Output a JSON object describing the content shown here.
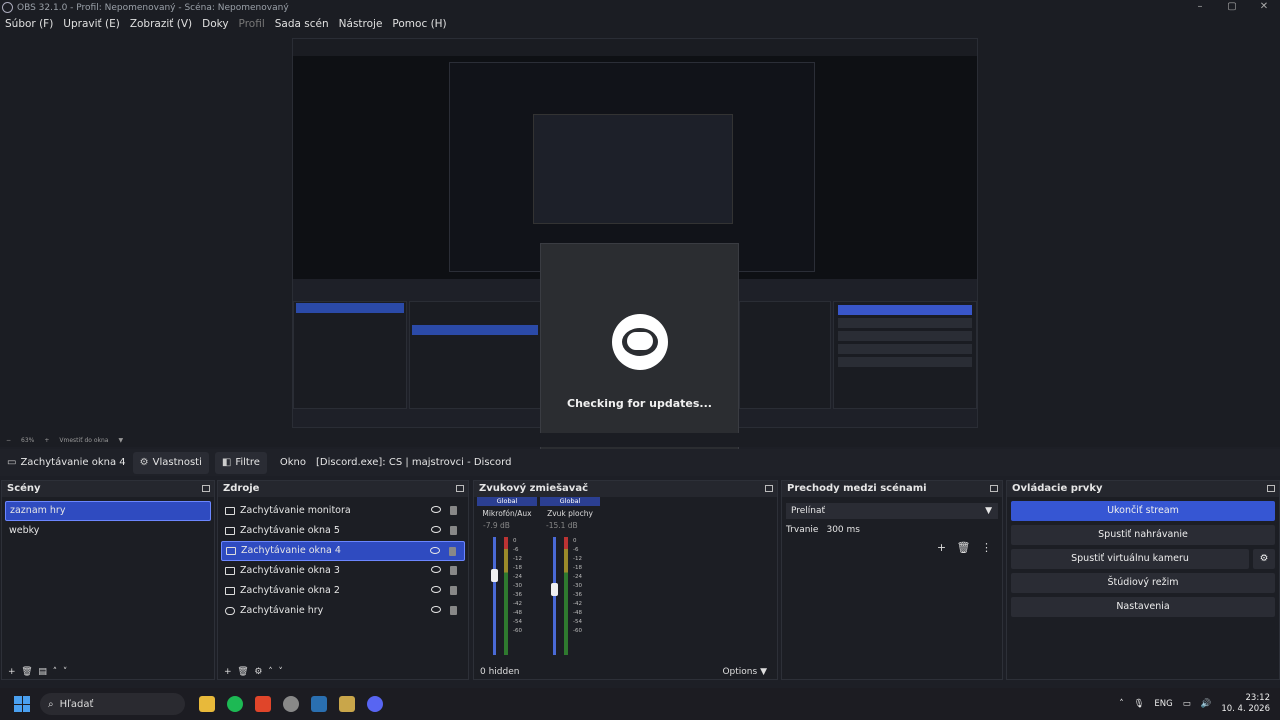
{
  "window": {
    "title": "OBS 32.1.0 - Profil: Nepomenovaný - Scéna: Nepomenovaný"
  },
  "menu": [
    {
      "label": "Súbor (F)"
    },
    {
      "label": "Upraviť (E)"
    },
    {
      "label": "Zobraziť (V)"
    },
    {
      "label": "Doky"
    },
    {
      "label": "Profil"
    },
    {
      "label": "Sada scén"
    },
    {
      "label": "Nástroje"
    },
    {
      "label": "Pomoc (H)"
    }
  ],
  "splash": {
    "message": "Checking for updates..."
  },
  "zoom": {
    "level": "63%",
    "fit": "Vmestiť do okna"
  },
  "source_bar": {
    "selected_source": "Zachytávanie okna 4",
    "properties": "Vlastnosti",
    "filters": "Filtre",
    "window_label": "Okno",
    "window_value": "[Discord.exe]: CS | majstrovci - Discord"
  },
  "scenes": {
    "title": "Scény",
    "items": [
      {
        "label": "zaznam hry"
      },
      {
        "label": "webky"
      }
    ]
  },
  "sources": {
    "title": "Zdroje",
    "items": [
      {
        "label": "Zachytávanie monitora"
      },
      {
        "label": "Zachytávanie okna 5"
      },
      {
        "label": "Zachytávanie okna 4"
      },
      {
        "label": "Zachytávanie okna 3"
      },
      {
        "label": "Zachytávanie okna 2"
      },
      {
        "label": "Zachytávanie hry"
      }
    ]
  },
  "mixer": {
    "title": "Zvukový zmiešavač",
    "channels": [
      {
        "tag": "Global",
        "name": "Mikrofón/Aux",
        "db": "-7.9 dB"
      },
      {
        "tag": "Global",
        "name": "Zvuk plochy",
        "db": "-15.1 dB"
      }
    ],
    "ticks": [
      "0",
      "-6",
      "-12",
      "-18",
      "-24",
      "-30",
      "-36",
      "-42",
      "-48",
      "-54",
      "-60"
    ],
    "hidden": "0 hidden",
    "options": "Options"
  },
  "transitions": {
    "title": "Prechody medzi scénami",
    "selected": "Prelínať",
    "duration_label": "Trvanie",
    "duration_value": "300 ms"
  },
  "controls": {
    "title": "Ovládacie prvky",
    "stop_stream": "Ukončiť stream",
    "start_recording": "Spustiť nahrávanie",
    "start_virtualcam": "Spustiť virtuálnu kameru",
    "studio_mode": "Štúdiový režim",
    "settings": "Nastavenia"
  },
  "taskbar": {
    "search": "Hľadať",
    "lang": "ENG",
    "time": "23:12",
    "date": "10. 4. 2026"
  },
  "colors": {
    "accent": "#3656d3",
    "selection": "#2f4bc0"
  }
}
